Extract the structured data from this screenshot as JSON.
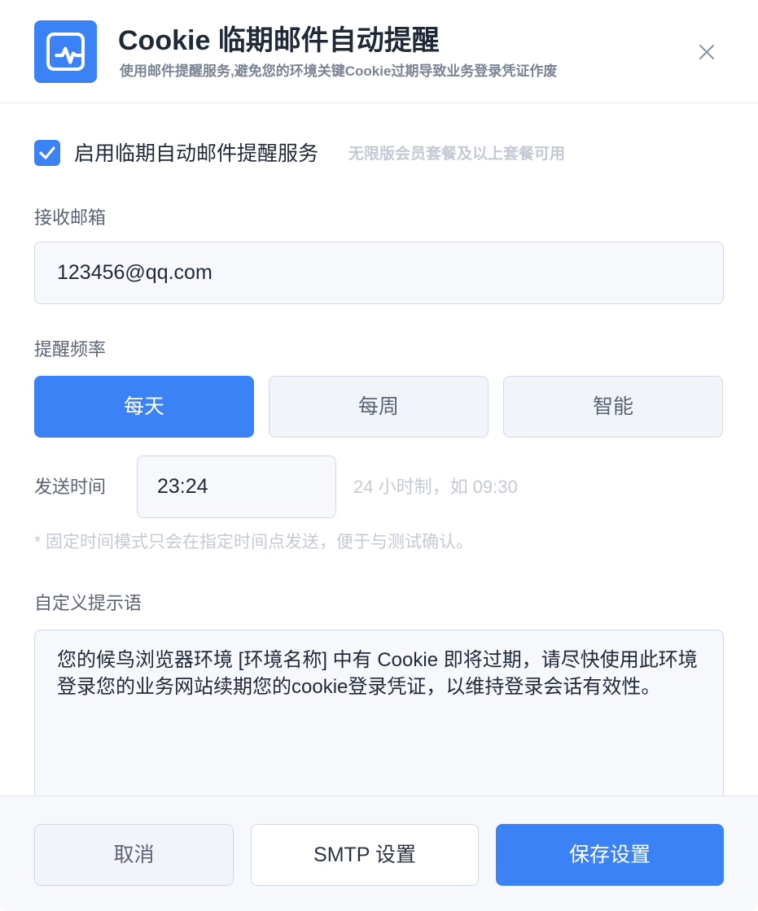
{
  "header": {
    "title": "Cookie 临期邮件自动提醒",
    "subtitle": "使用邮件提醒服务,避免您的环境关键Cookie过期导致业务登录凭证作废",
    "icon": "activity-pulse-icon",
    "close_icon": "close-icon"
  },
  "enable": {
    "checked": true,
    "label": "启用临期自动邮件提醒服务",
    "hint": "无限版会员套餐及以上套餐可用"
  },
  "email": {
    "label": "接收邮箱",
    "value": "123456@qq.com"
  },
  "frequency": {
    "label": "提醒频率",
    "options": [
      {
        "label": "每天",
        "selected": true
      },
      {
        "label": "每周",
        "selected": false
      },
      {
        "label": "智能",
        "selected": false
      }
    ]
  },
  "send_time": {
    "label": "发送时间",
    "value": "23:24",
    "hint": "24 小时制，如 09:30",
    "note": "* 固定时间模式只会在指定时间点发送，便于与测试确认。"
  },
  "custom_message": {
    "label": "自定义提示语",
    "value": "您的候鸟浏览器环境 [环境名称] 中有 Cookie 即将过期，请尽快使用此环境登录您的业务网站续期您的cookie登录凭证，以维持登录会话有效性。"
  },
  "footer": {
    "cancel_label": "取消",
    "smtp_label": "SMTP 设置",
    "save_label": "保存设置"
  },
  "colors": {
    "accent": "#3b82f6",
    "muted_text": "#c4cad3"
  }
}
